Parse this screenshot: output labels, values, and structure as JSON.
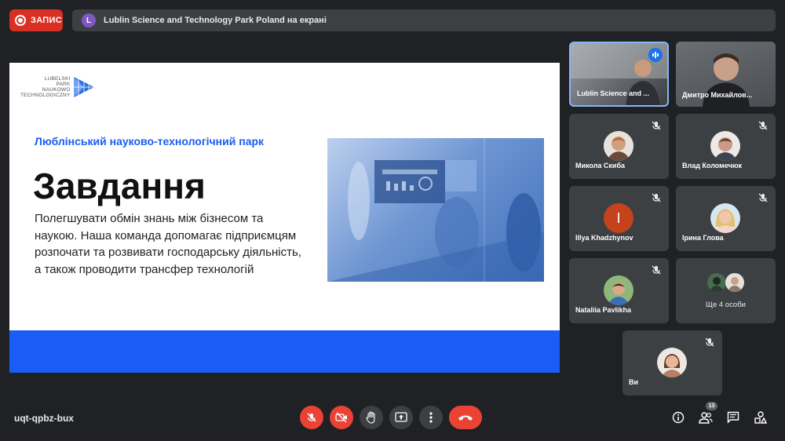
{
  "recording": {
    "label": "ЗАПИС"
  },
  "presenting": {
    "avatar_letter": "L",
    "text": "Lublin Science and Technology Park Poland на екрані"
  },
  "slide": {
    "logo_lines": [
      "LUBELSKI",
      "PARK",
      "NAUKOWO",
      "TECHNOLOGICZNY"
    ],
    "subtitle": "Люблінський науково-технологічний парк",
    "title": "Завдання",
    "body": "Полегшувати обмін знань між бізнесом та наукою. Наша команда допомагає підприємцям розпочати та розвивати господарську діяльність, а також проводити трансфер технологій"
  },
  "participants": [
    {
      "name": "Lublin Science and ...",
      "type": "video",
      "speaking": true
    },
    {
      "name": "Дмитро Михайлов...",
      "type": "video"
    },
    {
      "name": "Микола Скиба",
      "type": "avatar",
      "muted": true
    },
    {
      "name": "Влад Коломечюк",
      "type": "avatar",
      "muted": true
    },
    {
      "name": "Illya Khadzhynov",
      "type": "letter",
      "letter": "I",
      "color": "#c5421c",
      "muted": true
    },
    {
      "name": "Ірина Глова",
      "type": "avatar",
      "muted": true
    },
    {
      "name": "Nataliia Pavlikha",
      "type": "avatar",
      "muted": true
    },
    {
      "name": "Ще 4 особи",
      "type": "group"
    },
    {
      "name": "Ви",
      "type": "avatar",
      "muted": true
    }
  ],
  "meeting_code": "uqt-qpbz-bux",
  "controls": [
    "mic-off",
    "camera-off",
    "raise-hand",
    "present-screen",
    "more-options",
    "leave-call"
  ],
  "participants_count": "13",
  "right_controls": [
    "meeting-details",
    "people",
    "chat",
    "activities"
  ],
  "colors": {
    "accent_red": "#ea4335",
    "slide_blue": "#1a5cf5",
    "tile_bg": "#3c4043",
    "page_bg": "#202124"
  }
}
